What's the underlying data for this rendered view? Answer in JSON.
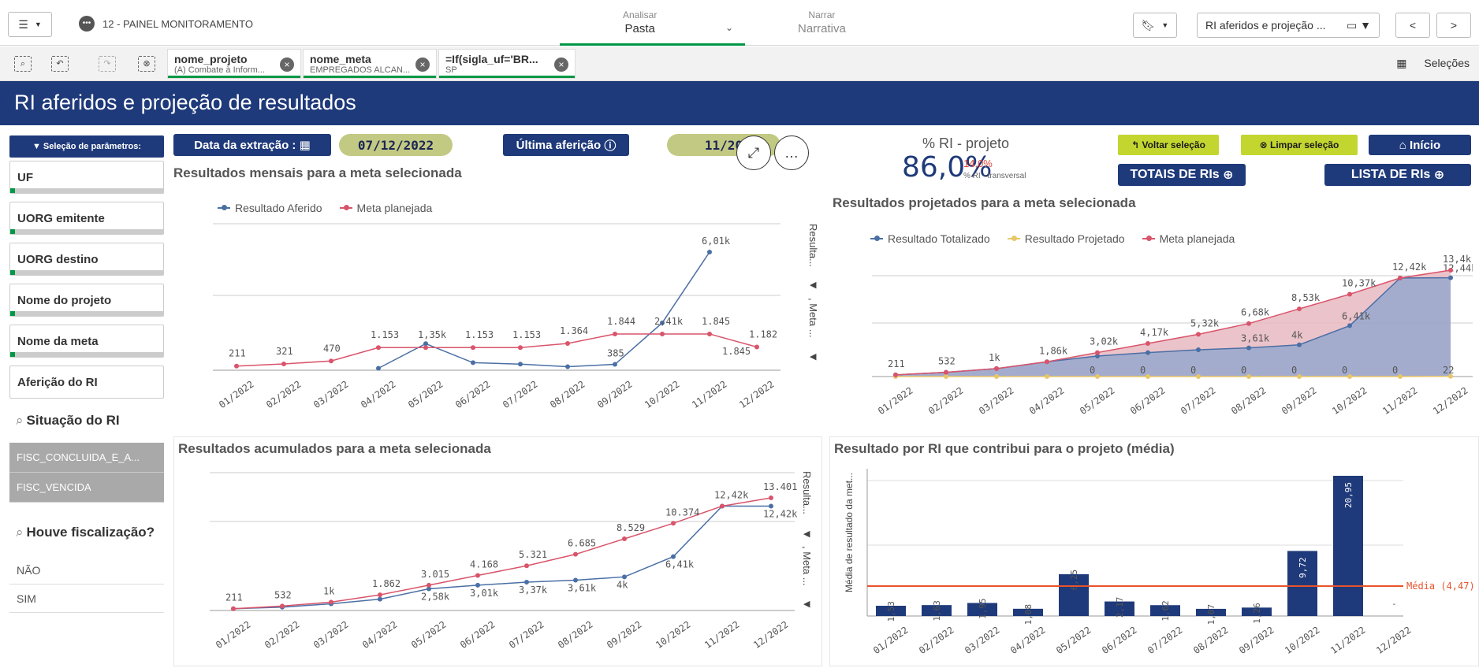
{
  "topbar": {
    "app_title": "12 - PAINEL MONITORAMENTO",
    "analyze_label": "Analisar",
    "analyze_sub": "Pasta",
    "narrate_label": "Narrar",
    "narrate_sub": "Narrativa",
    "sheet_selector": "RI aferidos e projeção ...",
    "prev": "<",
    "next": ">"
  },
  "selections": {
    "chips": [
      {
        "field": "nome_projeto",
        "value": "(A) Combate à Inform..."
      },
      {
        "field": "nome_meta",
        "value": "EMPREGADOS ALCAN..."
      },
      {
        "field": "=If(sigla_uf='BR...",
        "value": "SP"
      }
    ],
    "selecoes_label": "Seleções"
  },
  "title": "RI aferidos e projeção de resultados",
  "sidebar": {
    "param_button": "▼ Seleção de parâmetros:",
    "filters": [
      "UF",
      "UORG emitente",
      "UORG destino",
      "Nome do projeto",
      "Nome da meta",
      "Aferição do RI"
    ],
    "situacao_title": "Situação do RI",
    "situacao_items": [
      "FISC_CONCLUIDA_E_A...",
      "FISC_VENCIDA"
    ],
    "fisc_title": "Houve fiscalização?",
    "fisc_items": [
      "NÃO",
      "SIM"
    ]
  },
  "header": {
    "data_extracao_label": "Data da extração :",
    "data_extracao_value": "07/12/2022",
    "ultima_afericao_label": "Última aferição",
    "ultima_afericao_value": "11/20",
    "kpi_title": "% RI - projeto",
    "kpi_value": "86,0%",
    "kpi_secondary": "14,0%",
    "kpi_secondary_label": "% RI - transversal",
    "voltar": "Voltar seleção",
    "limpar": "Limpar seleção",
    "inicio": "Início",
    "totais": "TOTAIS DE RIs",
    "lista": "LISTA DE RIs"
  },
  "charts": {
    "monthly_vert_label_1": "Resulta...",
    "monthly_vert_label_2": ", Meta ...",
    "acum_vert_label_1": "Resulta...",
    "acum_vert_label_2": ", Meta ...",
    "bar_ylabel": "Média de resultado da met...",
    "bar_media": "Média (4,47)"
  },
  "chart_data": [
    {
      "type": "line",
      "title": "Resultados mensais para a meta selecionada",
      "categories": [
        "01/2022",
        "02/2022",
        "03/2022",
        "04/2022",
        "05/2022",
        "06/2022",
        "07/2022",
        "08/2022",
        "09/2022",
        "10/2022",
        "11/2022",
        "12/2022"
      ],
      "series": [
        {
          "name": "Resultado Aferido",
          "color": "#4a6fa5",
          "values": [
            null,
            null,
            null,
            100,
            1350,
            385,
            310,
            180,
            300,
            2410,
            6010,
            null
          ]
        },
        {
          "name": "Meta planejada",
          "color": "#d9546b",
          "values": [
            211,
            321,
            470,
            1153,
            1153,
            1153,
            1153,
            1364,
            1844,
            1845,
            1845,
            1182
          ]
        }
      ],
      "labels": {
        "Meta planejada": [
          "211",
          "321",
          "470",
          "1.153",
          "1,35k",
          "1.153",
          "1.153",
          "1.364",
          "1.844",
          "2,41k",
          "1.845",
          "1.182"
        ],
        "Resultado Aferido": [
          "",
          "",
          "",
          "",
          "",
          "",
          "",
          "",
          "385",
          "",
          "6,01k",
          ""
        ],
        "extra": [
          "1.845"
        ]
      }
    },
    {
      "type": "area",
      "title": "Resultados projetados para a meta selecionada",
      "categories": [
        "01/2022",
        "02/2022",
        "03/2022",
        "04/2022",
        "05/2022",
        "06/2022",
        "07/2022",
        "08/2022",
        "09/2022",
        "10/2022",
        "11/2022",
        "12/2022"
      ],
      "series": [
        {
          "name": "Resultado Totalizado",
          "color": "#4a6fa5",
          "values": [
            211,
            532,
            1000,
            1862,
            2580,
            3010,
            3370,
            3610,
            4000,
            6410,
            12420,
            12440
          ]
        },
        {
          "name": "Resultado Projetado",
          "color": "#e8c76a",
          "values": [
            0,
            0,
            0,
            0,
            0,
            0,
            0,
            0,
            0,
            0,
            0,
            22
          ]
        },
        {
          "name": "Meta planejada",
          "color": "#d9546b",
          "values": [
            211,
            532,
            1000,
            1860,
            3020,
            4170,
            5320,
            6680,
            8530,
            10370,
            12420,
            13400
          ]
        }
      ],
      "labels": {
        "Meta planejada": [
          "211",
          "532",
          "1k",
          "1,86k",
          "3,02k",
          "4,17k",
          "5,32k",
          "6,68k",
          "8,53k",
          "10,37k",
          "12,42k",
          "13,4k"
        ],
        "Resultado Totalizado": [
          "",
          "",
          "",
          "",
          "",
          "",
          "",
          "3,61k",
          "4k",
          "6,41k",
          "",
          "12,44k"
        ],
        "Resultado Projetado": [
          "",
          "",
          "",
          "",
          "0",
          "0",
          "0",
          "0",
          "0",
          "0",
          "0",
          "22"
        ]
      }
    },
    {
      "type": "line",
      "title": "Resultados acumulados para a meta selecionada",
      "categories": [
        "01/2022",
        "02/2022",
        "03/2022",
        "04/2022",
        "05/2022",
        "06/2022",
        "07/2022",
        "08/2022",
        "09/2022",
        "10/2022",
        "11/2022",
        "12/2022"
      ],
      "series": [
        {
          "name": "Resultado Aferido",
          "color": "#4a6fa5",
          "values": [
            211,
            400,
            800,
            1350,
            2580,
            3010,
            3370,
            3610,
            4000,
            6410,
            12420,
            12420
          ]
        },
        {
          "name": "Meta planejada",
          "color": "#d9546b",
          "values": [
            211,
            532,
            1000,
            1862,
            3015,
            4168,
            5321,
            6685,
            8529,
            10374,
            12420,
            13401
          ]
        }
      ],
      "labels": {
        "Meta planejada": [
          "211",
          "532",
          "1k",
          "1.862",
          "3.015",
          "4.168",
          "5.321",
          "6.685",
          "8.529",
          "10.374",
          "12,42k",
          "13.401"
        ],
        "Resultado Aferido": [
          "",
          "",
          "",
          "",
          "2,58k",
          "3,01k",
          "3,37k",
          "3,61k",
          "4k",
          "6,41k",
          "",
          "12,42k"
        ]
      }
    },
    {
      "type": "bar",
      "title": "Resultado por RI que contribui para o projeto (média)",
      "ylabel": "Média de resultado da met...",
      "categories": [
        "01/2022",
        "02/2022",
        "03/2022",
        "04/2022",
        "05/2022",
        "06/2022",
        "07/2022",
        "08/2022",
        "09/2022",
        "10/2022",
        "11/2022",
        "12/2022"
      ],
      "values": [
        1.53,
        1.63,
        1.95,
        1.08,
        6.25,
        2.17,
        1.62,
        1.07,
        1.26,
        9.72,
        20.95,
        null
      ],
      "labels": [
        "1,53",
        "1,63",
        "1,95",
        "1,08",
        "6,25",
        "2,17",
        "1,62",
        "1,07",
        "1,26",
        "9,72",
        "20,95",
        "-"
      ],
      "reference_line": {
        "label": "Média (4,47)",
        "value": 4.47
      }
    }
  ]
}
